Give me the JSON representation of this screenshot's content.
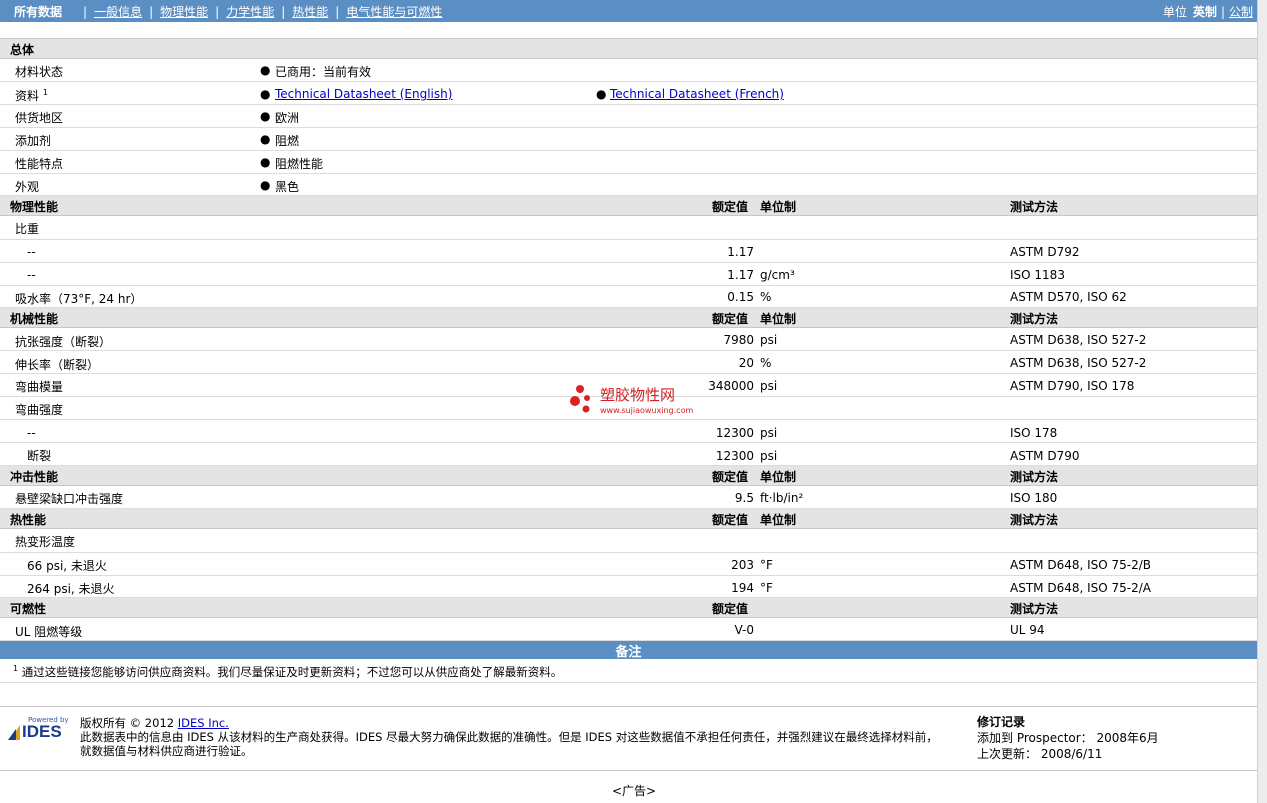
{
  "nav": {
    "all": "所有数据",
    "items": [
      "一般信息",
      "物理性能",
      "力学性能",
      "热性能",
      "电气性能与可燃性"
    ],
    "unit_label": "单位",
    "unit_english": "英制",
    "unit_metric": "公制"
  },
  "general": {
    "title": "总体",
    "rows": [
      {
        "label": "材料状态",
        "value": "已商用：当前有效"
      },
      {
        "label": "资料",
        "sup": "1",
        "value": "Technical Datasheet (English)",
        "value2": "Technical Datasheet (French)"
      },
      {
        "label": "供货地区",
        "value": "欧洲"
      },
      {
        "label": "添加剂",
        "value": "阻燃"
      },
      {
        "label": "性能特点",
        "value": "阻燃性能"
      },
      {
        "label": "外观",
        "value": "黑色"
      }
    ]
  },
  "headers": {
    "rated": "额定值",
    "unit": "单位制",
    "method": "测试方法"
  },
  "physical": {
    "title": "物理性能",
    "r1_label": "比重",
    "r2": {
      "label": "--",
      "value": "1.17",
      "unit": "",
      "method": "ASTM D792"
    },
    "r3": {
      "label": "--",
      "value": "1.17",
      "unit": "g/cm³",
      "method": "ISO 1183"
    },
    "r4": {
      "label": "吸水率（73°F, 24 hr）",
      "value": "0.15",
      "unit": "%",
      "method": "ASTM D570, ISO 62"
    }
  },
  "mechanical": {
    "title": "机械性能",
    "r1": {
      "label": "抗张强度（断裂）",
      "value": "7980",
      "unit": "psi",
      "method": "ASTM D638, ISO 527-2"
    },
    "r2": {
      "label": "伸长率（断裂）",
      "value": "20",
      "unit": "%",
      "method": "ASTM D638, ISO 527-2"
    },
    "r3": {
      "label": "弯曲模量",
      "value": "348000",
      "unit": "psi",
      "method": "ASTM D790, ISO 178"
    },
    "r4_label": "弯曲强度",
    "r5": {
      "label": "--",
      "value": "12300",
      "unit": "psi",
      "method": "ISO 178"
    },
    "r6": {
      "label": "断裂",
      "value": "12300",
      "unit": "psi",
      "method": "ASTM D790"
    }
  },
  "impact": {
    "title": "冲击性能",
    "r1": {
      "label": "悬壁梁缺口冲击强度",
      "value": "9.5",
      "unit": "ft·lb/in²",
      "method": "ISO 180"
    }
  },
  "thermal": {
    "title": "热性能",
    "r1_label": "热变形温度",
    "r2": {
      "label": "66 psi, 未退火",
      "value": "203",
      "unit": "°F",
      "method": "ASTM D648, ISO 75-2/B"
    },
    "r3": {
      "label": "264 psi, 未退火",
      "value": "194",
      "unit": "°F",
      "method": "ASTM D648, ISO 75-2/A"
    }
  },
  "flammability": {
    "title": "可燃性",
    "r1": {
      "label": "UL 阻燃等级",
      "value": "V-0",
      "method": "UL 94"
    }
  },
  "notes": {
    "title": "备注",
    "sup": "1",
    "text": "通过这些链接您能够访问供应商资料。我们尽量保证及时更新资料；不过您可以从供应商处了解最新资料。"
  },
  "watermark": {
    "text": "塑胶物性网",
    "url": "www.sujiaowuxing.com"
  },
  "footer": {
    "logo_powered": "Powered by",
    "logo_name": "IDES",
    "copyright": "版权所有 © 2012",
    "copyright_link": "IDES Inc.",
    "line2": "此数据表中的信息由 IDES 从该材料的生产商处获得。IDES 尽最大努力确保此数据的准确性。但是 IDES 对这些数据值不承担任何责任，并强烈建议在最终选择材料前，",
    "line3": "就数据值与材料供应商进行验证。",
    "rev_title": "修订记录",
    "rev_added": "添加到 Prospector： 2008年6月",
    "rev_updated": "上次更新： 2008/6/11"
  },
  "ad": "<广告>"
}
